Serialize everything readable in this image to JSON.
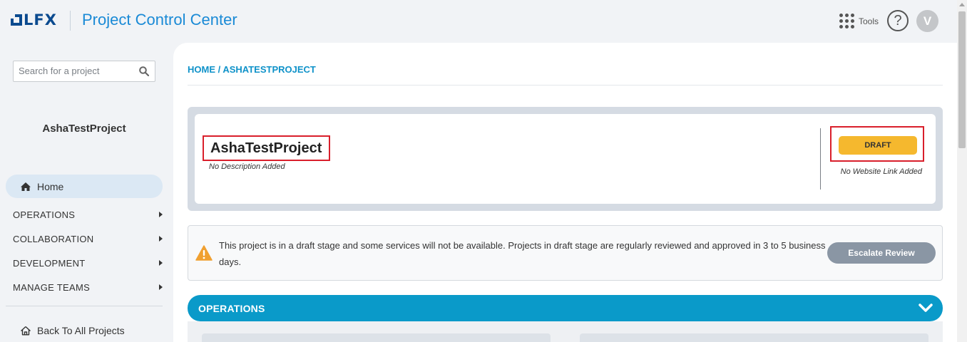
{
  "header": {
    "logo_text": "LFX",
    "app_title": "Project Control Center",
    "tools_label": "Tools",
    "help_icon": "question-circle-icon",
    "avatar_initial": "V"
  },
  "sidebar": {
    "search_placeholder": "Search for a project",
    "project_name": "AshaTestProject",
    "home_label": "Home",
    "nav_items": [
      {
        "label": "OPERATIONS"
      },
      {
        "label": "COLLABORATION"
      },
      {
        "label": "DEVELOPMENT"
      },
      {
        "label": "MANAGE TEAMS"
      }
    ],
    "back_label": "Back To All Projects"
  },
  "main": {
    "breadcrumb": "HOME / ASHATESTPROJECT",
    "project": {
      "name": "AshaTestProject",
      "description": "No Description Added",
      "status": "DRAFT",
      "website": "No Website Link Added"
    },
    "notice": {
      "text": "This project is in a draft stage and some services will not be available. Projects in draft stage are regularly reviewed and approved in 3 to 5 business days.",
      "button": "Escalate Review"
    },
    "operations_title": "OPERATIONS"
  },
  "colors": {
    "accent": "#0a9ac9",
    "brand_blue": "#1a8ad6",
    "draft_yellow": "#f5b82e",
    "highlight_red": "#d91f2b",
    "escalate_gray": "#8a96a4",
    "warning_orange": "#f0a030"
  }
}
